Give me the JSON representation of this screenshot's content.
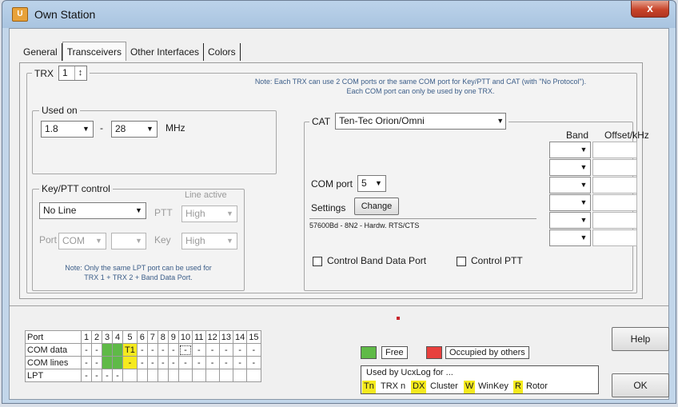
{
  "window": {
    "title": "Own Station",
    "icon": "app-logo-icon",
    "close_glyph": "x"
  },
  "tabs": [
    "General",
    "Transceivers",
    "Other Interfaces",
    "Colors"
  ],
  "active_tab": "Transceivers",
  "trx": {
    "label": "TRX",
    "value": "1",
    "spin_glyph": "↕",
    "note_line1": "Note: Each TRX can use 2 COM ports or the same COM port for Key/PTT and CAT (with \"No Protocol\").",
    "note_line2": "Each COM port can only be used by one TRX."
  },
  "used_on": {
    "label": "Used on",
    "from": "1.8",
    "separator": "-",
    "to": "28",
    "unit": "MHz"
  },
  "key_ptt": {
    "label": "Key/PTT control",
    "line": "No Line",
    "line_active_label": "Line active",
    "ptt_label": "PTT",
    "ptt_value": "High",
    "port_label": "Port",
    "port_value": "COM",
    "port_number_value": "",
    "key_label": "Key",
    "key_value": "High",
    "note_line1": "Note: Only the same LPT port can be used for",
    "note_line2": "TRX 1 + TRX 2 + Band Data Port."
  },
  "cat": {
    "label": "CAT",
    "protocol": "Ten-Tec Orion/Omni",
    "com_port_label": "COM port",
    "com_port_value": "5",
    "settings_label": "Settings",
    "change_button": "Change",
    "settings_text": "57600Bd - 8N2 - Hardw. RTS/CTS",
    "control_band_label": "Control Band Data Port",
    "control_ptt_label": "Control PTT",
    "band_header": "Band",
    "offset_header": "Offset/kHz",
    "band_rows": 6
  },
  "ports_table": {
    "header_label": "Port",
    "numbers": [
      "1",
      "2",
      "3",
      "4",
      "5",
      "6",
      "7",
      "8",
      "9",
      "10",
      "11",
      "12",
      "13",
      "14",
      "15"
    ],
    "rows": [
      {
        "label": "COM data",
        "cells": [
          "-",
          "-",
          "",
          "",
          "T1",
          "-",
          "-",
          "-",
          "-",
          "-",
          "-",
          "-",
          "-",
          "-",
          "-"
        ]
      },
      {
        "label": "COM lines",
        "cells": [
          "-",
          "-",
          "",
          "",
          "-",
          "-",
          "-",
          "-",
          "-",
          "-",
          "-",
          "-",
          "-",
          "-",
          "-"
        ]
      },
      {
        "label": "LPT",
        "cells": [
          "-",
          "-",
          "-",
          "-",
          "",
          "",
          "",
          "",
          "",
          "",
          "",
          "",
          "",
          "",
          ""
        ]
      }
    ]
  },
  "legend": {
    "free": "Free",
    "occupied": "Occupied by others",
    "used_by": "Used by UcxLog for ...",
    "tn": "Tn",
    "trx_n": "TRX n",
    "dx": "DX",
    "cluster": "Cluster",
    "w": "W",
    "winkey": "WinKey",
    "r": "R",
    "rotor": "Rotor"
  },
  "buttons": {
    "help": "Help",
    "ok": "OK"
  },
  "colors": {
    "free": "#5fba47",
    "occupied": "#e8403d",
    "used": "#f5ea1e",
    "note_text": "#3b5d88"
  }
}
